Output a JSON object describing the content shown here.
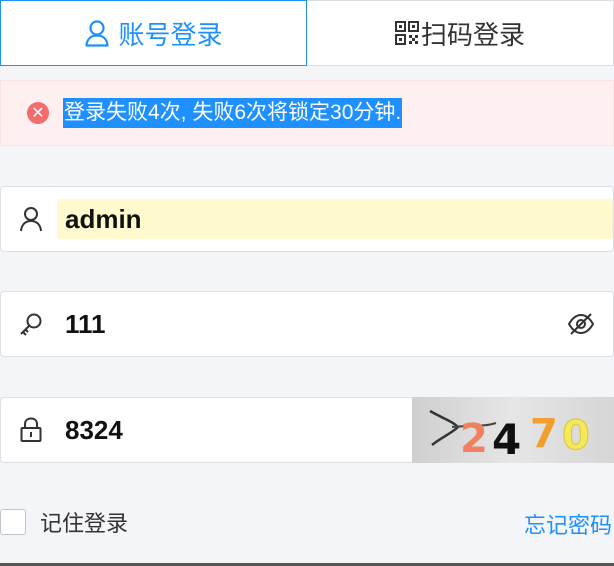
{
  "tabs": {
    "account_label": "账号登录",
    "qr_label": "扫码登录"
  },
  "error": {
    "message": "登录失败4次, 失败6次将锁定30分钟."
  },
  "username": {
    "value": "admin"
  },
  "password": {
    "value": "111"
  },
  "captcha": {
    "value": "8324",
    "image_text": "2470"
  },
  "remember": {
    "label": "记住登录"
  },
  "forgot": {
    "label": "忘记密码"
  },
  "colors": {
    "accent": "#1e90ff",
    "error_bg": "#fef0f0",
    "autofill_bg": "#fffacd"
  },
  "icons": [
    "user-icon",
    "qrcode-icon",
    "close-circle-icon",
    "key-icon",
    "eye-off-icon",
    "lock-icon"
  ]
}
